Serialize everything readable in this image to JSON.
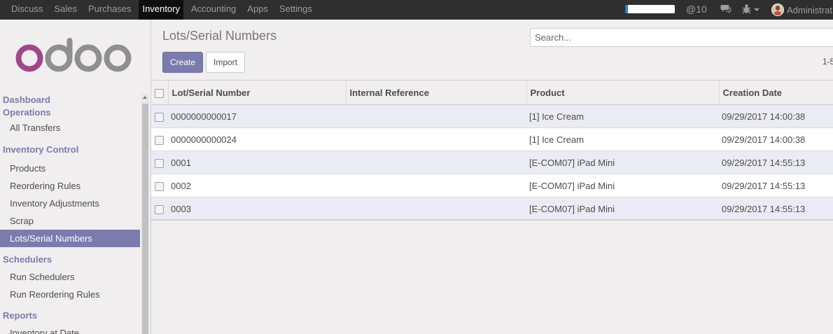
{
  "topbar": {
    "menu": [
      "Discuss",
      "Sales",
      "Purchases",
      "Inventory",
      "Accounting",
      "Apps",
      "Settings"
    ],
    "active_menu": "Inventory",
    "progress_fraction": 0.05,
    "mentions_count": "@10",
    "user_name": "Administrat"
  },
  "sidebar": {
    "logo_text": "odoo",
    "sections": [
      {
        "title": "Dashboard",
        "items": []
      },
      {
        "title": "Operations",
        "items": [
          "All Transfers"
        ]
      },
      {
        "title": "Inventory Control",
        "items": [
          "Products",
          "Reordering Rules",
          "Inventory Adjustments",
          "Scrap",
          "Lots/Serial Numbers"
        ]
      },
      {
        "title": "Schedulers",
        "items": [
          "Run Schedulers",
          "Run Reordering Rules"
        ]
      },
      {
        "title": "Reports",
        "items": [
          "Inventory at Date"
        ]
      }
    ],
    "active_item": "Lots/Serial Numbers"
  },
  "control_panel": {
    "breadcrumb": "Lots/Serial Numbers",
    "search_placeholder": "Search...",
    "create_label": "Create",
    "import_label": "Import",
    "pager": "1-5"
  },
  "table": {
    "columns": [
      "Lot/Serial Number",
      "Internal Reference",
      "Product",
      "Creation Date"
    ],
    "rows": [
      [
        "0000000000017",
        "",
        "[1] Ice Cream",
        "09/29/2017 14:00:38"
      ],
      [
        "0000000000024",
        "",
        "[1] Ice Cream",
        "09/29/2017 14:00:38"
      ],
      [
        "0001",
        "",
        "[E-COM07] iPad Mini",
        "09/29/2017 14:55:13"
      ],
      [
        "0002",
        "",
        "[E-COM07] iPad Mini",
        "09/29/2017 14:55:13"
      ],
      [
        "0003",
        "",
        "[E-COM07] iPad Mini",
        "09/29/2017 14:55:13"
      ]
    ]
  },
  "colors": {
    "brand": "#7c7bad",
    "navbar": "#2f2f2f",
    "odd_row": "#ebebf5"
  }
}
